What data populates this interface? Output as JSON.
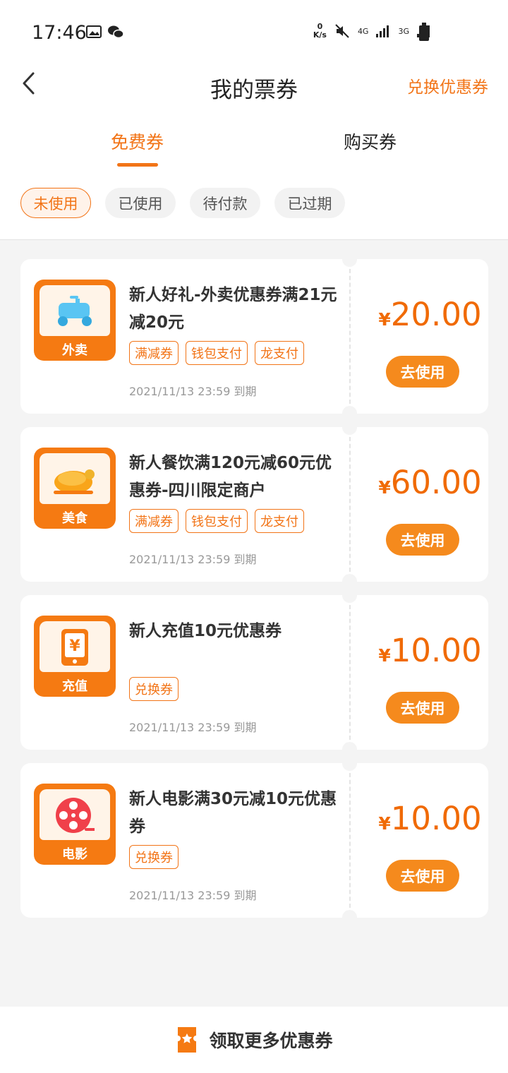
{
  "status": {
    "time": "17:46",
    "speed_top": "0",
    "speed_bottom": "K/s",
    "net1": "4G",
    "net2": "3G"
  },
  "header": {
    "title": "我的票券",
    "exchange": "兑换优惠券"
  },
  "tabs": [
    {
      "label": "免费券"
    },
    {
      "label": "购买券"
    }
  ],
  "filters": [
    {
      "label": "未使用"
    },
    {
      "label": "已使用"
    },
    {
      "label": "待付款"
    },
    {
      "label": "已过期"
    }
  ],
  "coupons": [
    {
      "category": "外卖",
      "title": "新人好礼-外卖优惠券满21元减20元",
      "tags": [
        "满减券",
        "钱包支付",
        "龙支付"
      ],
      "expiry": "2021/11/13 23:59 到期",
      "currency": "¥",
      "amount": "20.00",
      "button": "去使用"
    },
    {
      "category": "美食",
      "title": "新人餐饮满120元减60元优惠券-四川限定商户",
      "tags": [
        "满减券",
        "钱包支付",
        "龙支付"
      ],
      "expiry": "2021/11/13 23:59 到期",
      "currency": "¥",
      "amount": "60.00",
      "button": "去使用"
    },
    {
      "category": "充值",
      "title": "新人充值10元优惠券",
      "tags": [
        "兑换券"
      ],
      "expiry": "2021/11/13 23:59 到期",
      "currency": "¥",
      "amount": "10.00",
      "button": "去使用"
    },
    {
      "category": "电影",
      "title": "新人电影满30元减10元优惠券",
      "tags": [
        "兑换券"
      ],
      "expiry": "2021/11/13 23:59 到期",
      "currency": "¥",
      "amount": "10.00",
      "button": "去使用"
    }
  ],
  "bottom": {
    "label": "领取更多优惠券"
  },
  "colors": {
    "accent": "#f27417",
    "button": "#f58a1d",
    "price": "#f06a05"
  }
}
